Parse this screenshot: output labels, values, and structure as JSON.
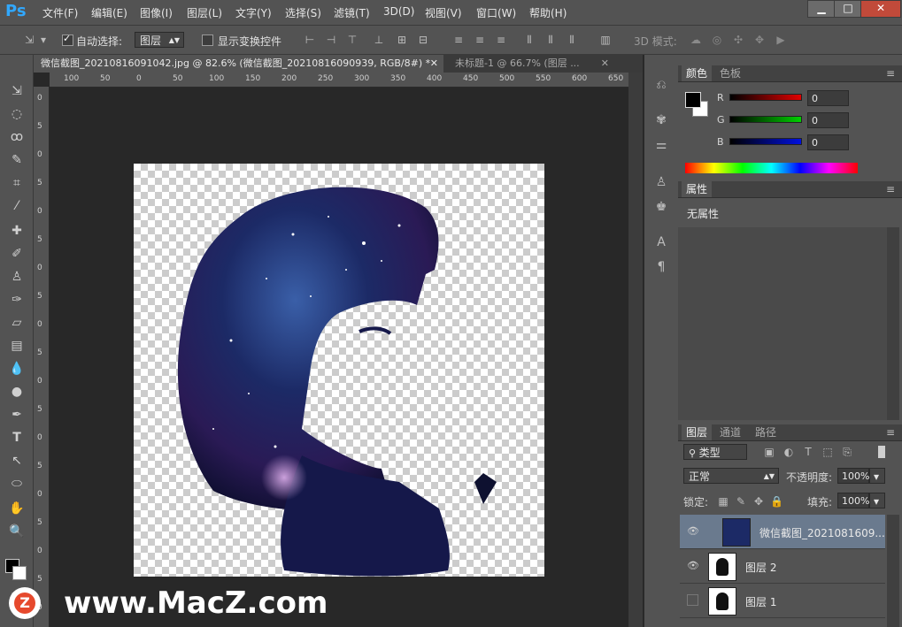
{
  "app": {
    "logo": "Ps"
  },
  "menu": [
    "文件(F)",
    "编辑(E)",
    "图像(I)",
    "图层(L)",
    "文字(Y)",
    "选择(S)",
    "滤镜(T)",
    "3D(D)",
    "视图(V)",
    "窗口(W)",
    "帮助(H)"
  ],
  "window_controls": {
    "minimize": "▁",
    "maximize": "□",
    "close": "✕"
  },
  "options": {
    "auto_select_label": "自动选择:",
    "auto_select_value": "图层",
    "show_transform_label": "显示变换控件",
    "mode3d_label": "3D 模式:"
  },
  "tabs": [
    {
      "label": "微信截图_20210816091042.jpg @ 82.6% (微信截图_20210816090939, RGB/8#) *",
      "close": "✕"
    },
    {
      "label": "未标题-1 @ 66.7% (图层 ...",
      "close": "✕"
    }
  ],
  "ruler": {
    "h": [
      "100",
      "50",
      "0",
      "50",
      "100",
      "150",
      "200",
      "250",
      "300",
      "350",
      "400",
      "450",
      "500",
      "550",
      "600",
      "650"
    ],
    "v": [
      "0",
      "5",
      "0",
      "5",
      "0",
      "5",
      "0",
      "5",
      "0",
      "5",
      "0",
      "5",
      "0",
      "5",
      "0",
      "5",
      "0",
      "5",
      "0"
    ]
  },
  "color_panel": {
    "tabs": [
      "颜色",
      "色板"
    ],
    "channels": [
      {
        "label": "R",
        "value": "0",
        "color": "#d02020"
      },
      {
        "label": "G",
        "value": "0",
        "color": "#20b020"
      },
      {
        "label": "B",
        "value": "0",
        "color": "#2030c0"
      }
    ]
  },
  "properties": {
    "tab": "属性",
    "text": "无属性"
  },
  "layers_panel": {
    "tabs": [
      "图层",
      "通道",
      "路径"
    ],
    "filter_kind": "类型",
    "blend_mode": "正常",
    "opacity_label": "不透明度:",
    "opacity_value": "100%",
    "lock_label": "锁定:",
    "fill_label": "填充:",
    "fill_value": "100%",
    "layers": [
      {
        "name": "微信截图_2021081609...",
        "visible": true,
        "selected": true
      },
      {
        "name": "图层 2",
        "visible": true,
        "selected": false
      },
      {
        "name": "图层 1",
        "visible": false,
        "selected": false
      }
    ]
  },
  "watermark": {
    "text": "www.MacZ.com",
    "badge": "Z"
  }
}
